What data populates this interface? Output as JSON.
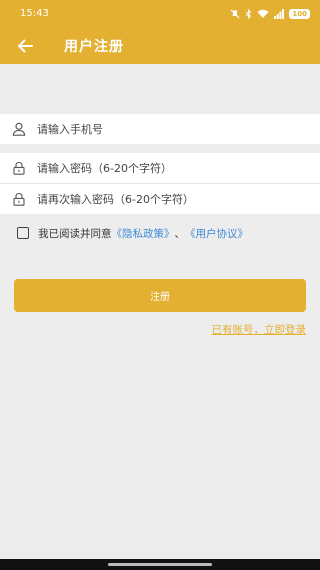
{
  "status_bar": {
    "time": "15:43",
    "icons": [
      "mute-icon",
      "bluetooth-icon",
      "wifi-icon",
      "signal-icon"
    ],
    "battery": "100"
  },
  "app_bar": {
    "back_icon": "arrow-left-icon",
    "title": "用户注册"
  },
  "form": {
    "phone": {
      "placeholder": "请输入手机号",
      "value": "",
      "icon": "user-icon"
    },
    "password": {
      "placeholder": "请输入密码（6-20个字符）",
      "value": "",
      "icon": "lock-icon"
    },
    "confirm_password": {
      "placeholder": "请再次输入密码（6-20个字符）",
      "value": "",
      "icon": "lock-icon"
    }
  },
  "agreement": {
    "checked": false,
    "prefix": "我已阅读并同意",
    "privacy_link": "《隐私政策》",
    "separator": "、",
    "terms_link": "《用户协议》"
  },
  "register_button": "注册",
  "login_link": "已有账号，立即登录",
  "colors": {
    "accent": "#e3b032",
    "background": "#ededed",
    "link": "#3f8cd6"
  }
}
